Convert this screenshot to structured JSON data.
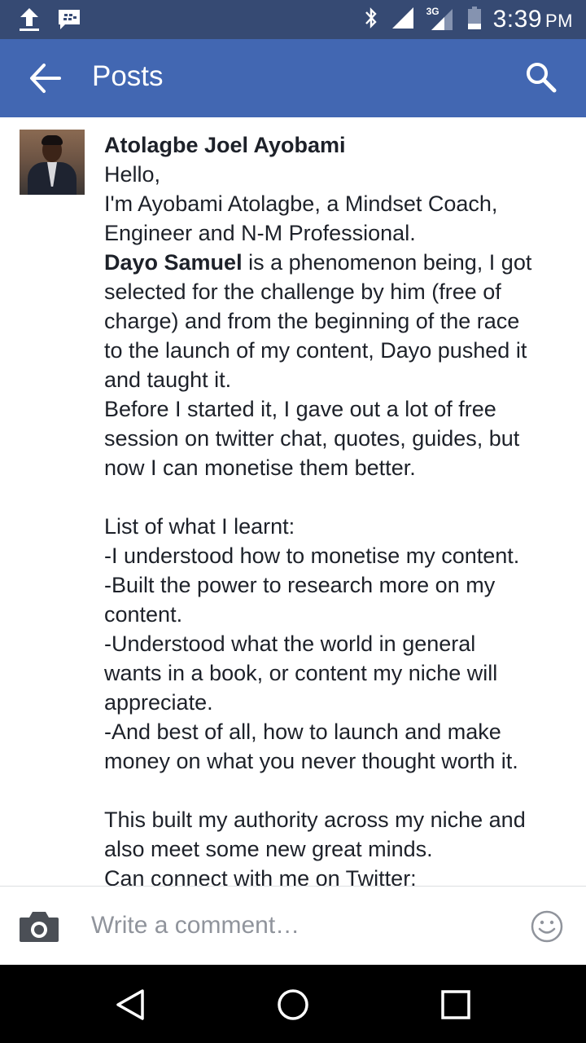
{
  "status_bar": {
    "time": "3:39",
    "ampm": "PM",
    "network": "3G",
    "icons": [
      "upload-icon",
      "bbm-icon",
      "bluetooth-icon",
      "signal-icon",
      "signal-3g-icon",
      "battery-icon"
    ]
  },
  "app_bar": {
    "title": "Posts",
    "back_icon": "arrow-left-icon",
    "search_icon": "search-icon",
    "bg_color": "#4267b2"
  },
  "post": {
    "author": "Atolagbe Joel Ayobami",
    "lines": [
      "Hello,",
      "I'm Ayobami Atolagbe, a Mindset Coach,",
      "Engineer and N-M Professional.",
      "__MENTION__",
      "selected for the challenge by him (free of",
      "charge) and from the beginning of the race",
      "to the launch of my content, Dayo pushed it",
      "and taught it.",
      "Before I started it, I gave out a lot of free",
      "session on twitter chat, quotes, guides, but",
      "now I can monetise them better.",
      "",
      "List of what I learnt:",
      "-I understood how to monetise my content.",
      "-Built the power to research more on my",
      "content.",
      "-Understood what the world in general",
      "wants in a book, or content my niche will",
      "appreciate.",
      "-And best of all, how to launch and make",
      "money on what you never thought worth it.",
      "",
      "This built my authority across my niche and",
      "also meet some new great minds.",
      "Can connect with me on Twitter:"
    ],
    "mention_name": "Dayo Samuel",
    "mention_rest": " is a phenomenon being, I got"
  },
  "comment_bar": {
    "placeholder": "Write a comment…",
    "camera_icon": "camera-icon",
    "smiley_icon": "smiley-icon"
  },
  "nav_bar": {
    "icons": [
      "back-triangle-icon",
      "home-circle-icon",
      "recents-square-icon"
    ]
  }
}
